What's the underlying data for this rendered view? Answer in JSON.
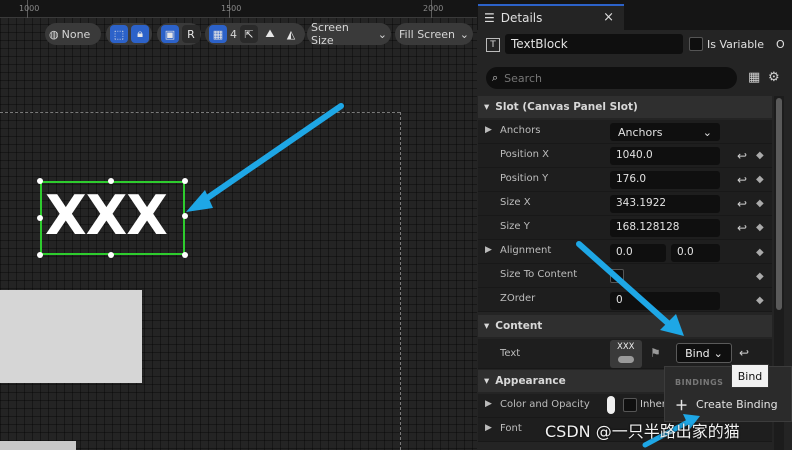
{
  "ruler": {
    "ticks": [
      "1000",
      "1500",
      "2000"
    ]
  },
  "viewport_toolbar": {
    "locale_label": "None",
    "r_label": "R",
    "grid_count": "4",
    "screen_size_label": "Screen Size",
    "fill_screen_label": "Fill Screen"
  },
  "canvas": {
    "textblock_text": "XXX"
  },
  "details": {
    "tab_title": "Details",
    "close_glyph": "×",
    "widget_name": "TextBlock",
    "is_variable_label": "Is Variable",
    "truncated_label": "O",
    "search_placeholder": "Search",
    "sections": {
      "slot": "Slot (Canvas Panel Slot)",
      "content": "Content",
      "appearance": "Appearance"
    },
    "slot_props": {
      "anchors_label": "Anchors",
      "anchors_value": "Anchors",
      "position_x_label": "Position X",
      "position_x_value": "1040.0",
      "position_y_label": "Position Y",
      "position_y_value": "176.0",
      "size_x_label": "Size X",
      "size_x_value": "343.1922",
      "size_y_label": "Size Y",
      "size_y_value": "168.128128",
      "alignment_label": "Alignment",
      "alignment_x_value": "0.0",
      "alignment_y_value": "0.0",
      "size_to_content_label": "Size To Content",
      "zorder_label": "ZOrder",
      "zorder_value": "0"
    },
    "content_props": {
      "text_label": "Text",
      "text_thumb": "XXX",
      "bind_label": "Bind"
    },
    "appearance_props": {
      "color_opacity_label": "Color and Opacity",
      "color_opacity_value": "Inher",
      "font_label": "Font"
    },
    "bind_tooltip": "Bind",
    "bindings_menu": {
      "header": "BINDINGS",
      "create_binding": "Create Binding"
    }
  },
  "watermark": "CSDN @一只半路出家的猫",
  "colors": {
    "selection_green": "#2ecc2e",
    "accent_blue": "#2c62c9",
    "annotation_arrow": "#1ea7e6"
  }
}
